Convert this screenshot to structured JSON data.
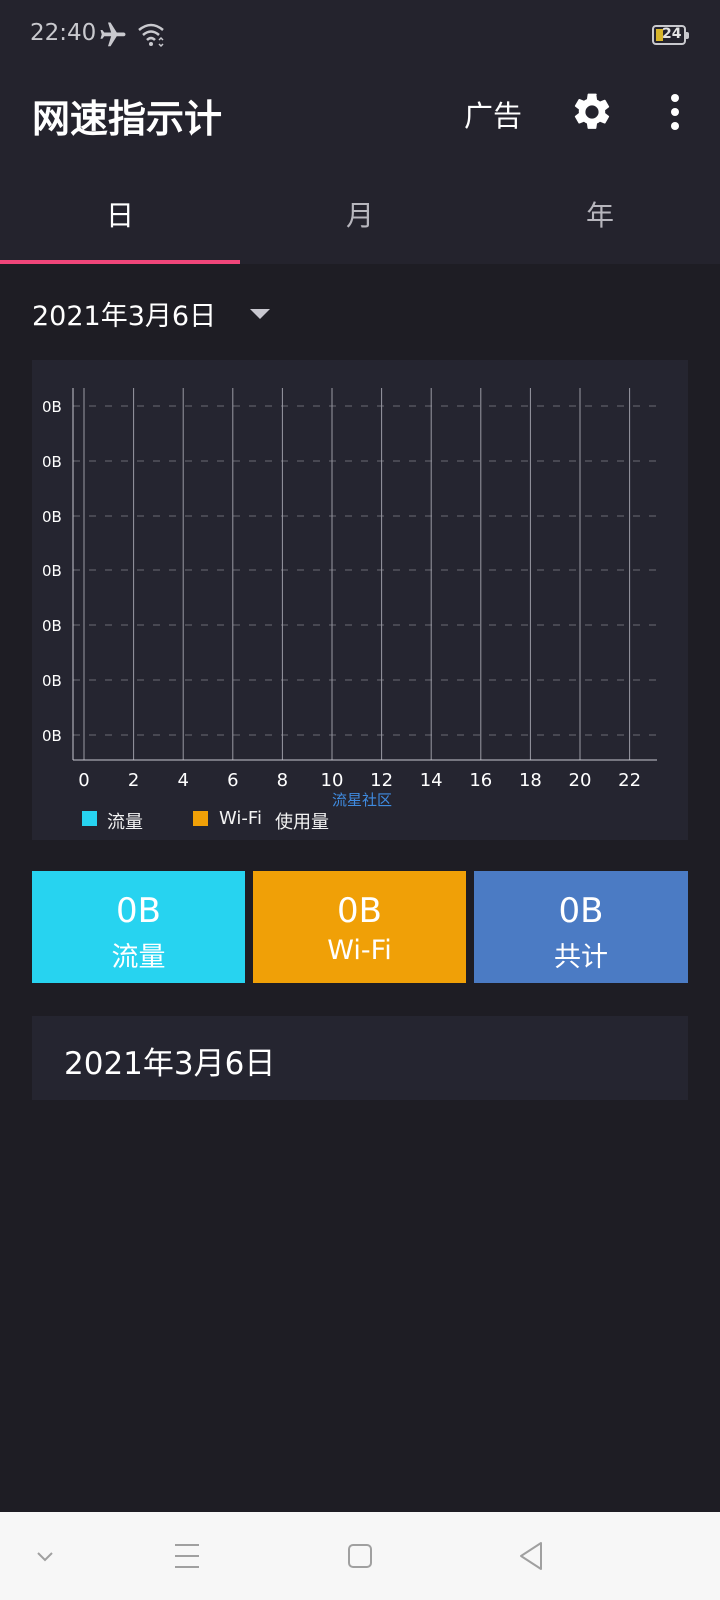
{
  "status_bar": {
    "time": "22:40",
    "battery": "24"
  },
  "app_bar": {
    "title": "网速指示计",
    "ad_label": "广告"
  },
  "tabs": [
    {
      "label": "日"
    },
    {
      "label": "月"
    },
    {
      "label": "年"
    }
  ],
  "date_selector": {
    "value": "2021年3月6日"
  },
  "chart_data": {
    "type": "bar",
    "categories": [
      "0",
      "1",
      "2",
      "3",
      "4",
      "5",
      "6",
      "7",
      "8",
      "9",
      "10",
      "11",
      "12",
      "13",
      "14",
      "15",
      "16",
      "17",
      "18",
      "19",
      "20",
      "21",
      "22",
      "23"
    ],
    "x_tick_labels": [
      "0",
      "2",
      "4",
      "6",
      "8",
      "10",
      "12",
      "14",
      "16",
      "18",
      "20",
      "22"
    ],
    "y_tick_labels": [
      "0B",
      "0B",
      "0B",
      "0B",
      "0B",
      "0B",
      "0B"
    ],
    "series": [
      {
        "name": "流量",
        "color": "#27d3f0",
        "values": [
          0,
          0,
          0,
          0,
          0,
          0,
          0,
          0,
          0,
          0,
          0,
          0,
          0,
          0,
          0,
          0,
          0,
          0,
          0,
          0,
          0,
          0,
          0,
          0
        ]
      },
      {
        "name": "Wi-Fi",
        "color": "#f0a007",
        "values": [
          0,
          0,
          0,
          0,
          0,
          0,
          0,
          0,
          0,
          0,
          0,
          0,
          0,
          0,
          0,
          0,
          0,
          0,
          0,
          0,
          0,
          0,
          0,
          0
        ]
      }
    ],
    "legend_extra": "使用量",
    "watermark": "流星社区",
    "grid": true
  },
  "summary": [
    {
      "value": "0B",
      "label": "流量",
      "color": "#27d3f0"
    },
    {
      "value": "0B",
      "label": "Wi-Fi",
      "color": "#f0a007"
    },
    {
      "value": "0B",
      "label": "共计",
      "color": "#4b7bc4"
    }
  ],
  "date_list": [
    {
      "date": "2021年3月6日"
    }
  ]
}
